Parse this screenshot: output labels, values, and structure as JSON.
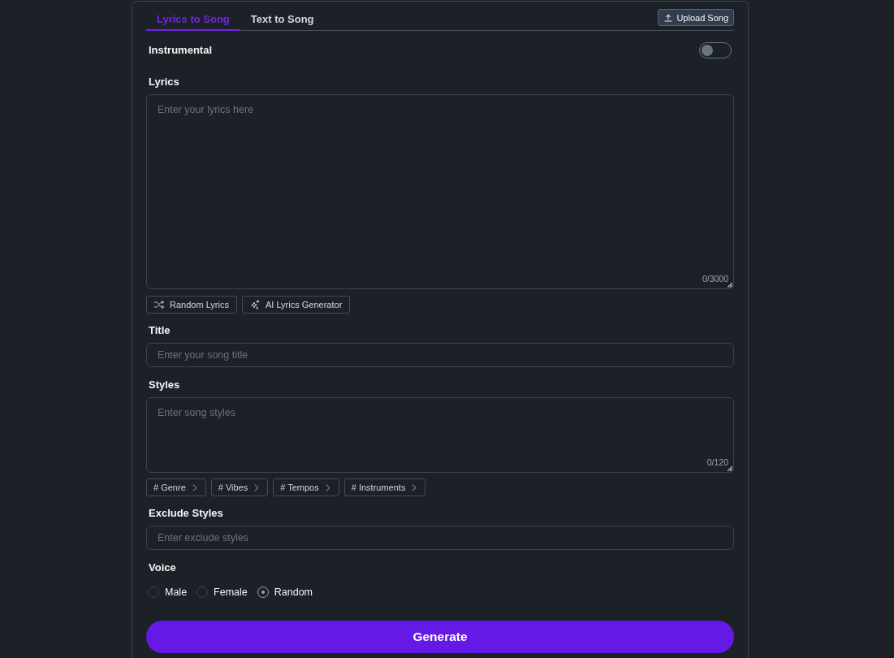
{
  "tabs": [
    {
      "label": "Lyrics to Song",
      "selected": true
    },
    {
      "label": "Text to Song",
      "selected": false
    }
  ],
  "upload_button": {
    "label": "Upload Song"
  },
  "instrumental": {
    "label": "Instrumental",
    "on": false
  },
  "lyrics": {
    "label": "Lyrics",
    "placeholder": "Enter your lyrics here",
    "counter": "0/3000"
  },
  "lyrics_actions": [
    "Random Lyrics",
    "AI Lyrics Generator"
  ],
  "title": {
    "label": "Title",
    "placeholder": "Enter your song title"
  },
  "styles": {
    "label": "Styles",
    "placeholder": "Enter song styles",
    "counter": "0/120"
  },
  "style_tags": [
    "# Genre",
    "# Vibes",
    "# Tempos",
    "# Instruments"
  ],
  "exclude_styles": {
    "label": "Exclude Styles",
    "placeholder": "Enter exclude styles"
  },
  "voice": {
    "label": "Voice",
    "options": [
      {
        "label": "Male",
        "selected": false
      },
      {
        "label": "Female",
        "selected": false
      },
      {
        "label": "Random",
        "selected": true
      }
    ]
  },
  "generate_button": {
    "label": "Generate"
  }
}
